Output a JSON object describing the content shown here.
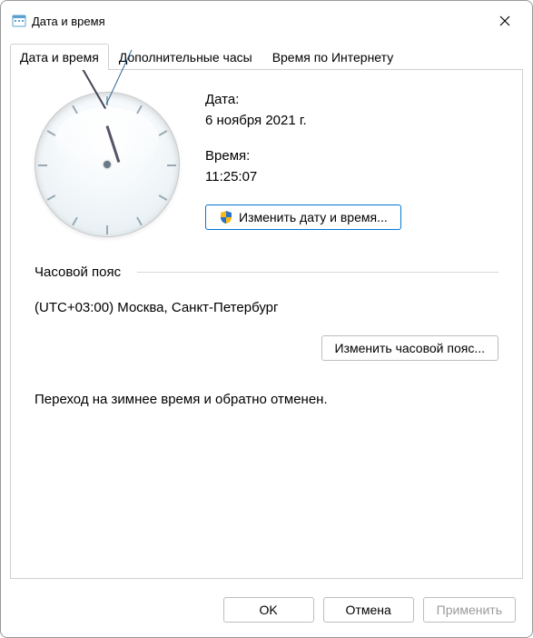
{
  "window": {
    "title": "Дата и время"
  },
  "tabs": {
    "dateTime": "Дата и время",
    "additionalClocks": "Дополнительные часы",
    "internetTime": "Время по Интернету"
  },
  "main": {
    "dateLabel": "Дата:",
    "dateValue": "6 ноября 2021 г.",
    "timeLabel": "Время:",
    "timeValue": "11:25:07",
    "changeDateTime": "Изменить дату и время...",
    "tzHeading": "Часовой пояс",
    "tzValue": "(UTC+03:00) Москва, Санкт-Петербург",
    "changeTz": "Изменить часовой пояс...",
    "dstNote": "Переход на зимнее время и обратно отменен."
  },
  "footer": {
    "ok": "OK",
    "cancel": "Отмена",
    "apply": "Применить"
  }
}
